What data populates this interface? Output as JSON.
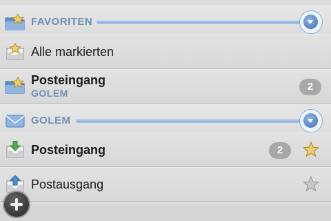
{
  "sections": {
    "favorites": {
      "label": "FAVORITEN",
      "icon": "folder-star-icon",
      "toggle_icon": "chevron-down-icon"
    },
    "golem": {
      "label": "GOLEM",
      "icon": "envelope-icon",
      "toggle_icon": "chevron-down-icon"
    }
  },
  "favorites_items": [
    {
      "title": "Alle markierten",
      "icon": "inbox-star-icon"
    },
    {
      "title": "Posteingang",
      "subtitle": "GOLEM",
      "badge": "2",
      "icon": "folder-star-icon"
    }
  ],
  "golem_items": [
    {
      "title": "Posteingang",
      "badge": "2",
      "icon": "inbox-download-icon",
      "starred": true
    },
    {
      "title": "Postausgang",
      "icon": "outbox-upload-icon",
      "starred": false
    }
  ],
  "colors": {
    "accent": "#6d8fb8",
    "badge_bg": "#a8a8a8",
    "star_gold": "#e9c44a"
  }
}
